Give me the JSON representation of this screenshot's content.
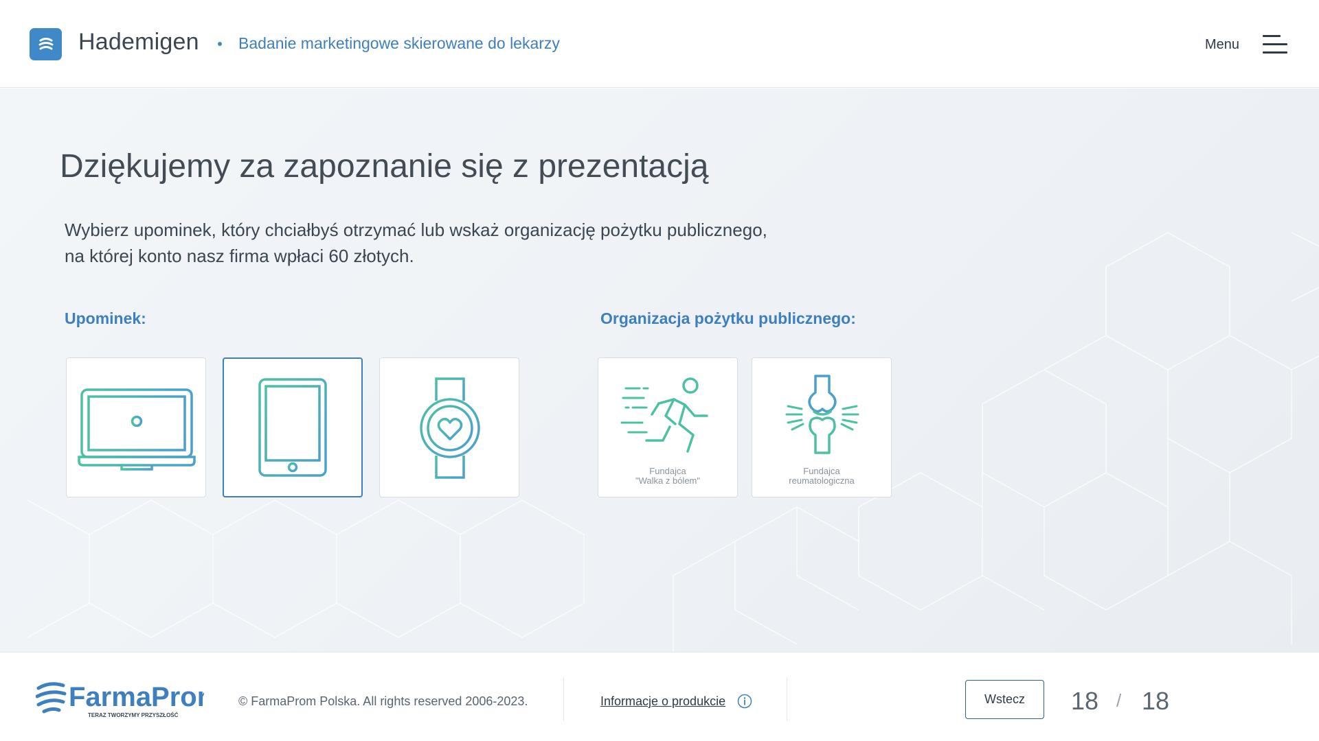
{
  "header": {
    "app_title": "Hademigen",
    "subtitle": "Badanie marketingowe skierowane do lekarzy",
    "menu_label": "Menu"
  },
  "main": {
    "title": "Dziękujemy za zapoznanie się z prezentacją",
    "intro_line1": "Wybierz upominek, który chciałbyś otrzymać lub wskaż organizację pożytku publicznego,",
    "intro_line2": "na której konto nasz firma wpłaci 60 złotych.",
    "gifts_label": "Upominek:",
    "gifts": [
      {
        "icon": "laptop-icon",
        "selected": false
      },
      {
        "icon": "tablet-icon",
        "selected": true
      },
      {
        "icon": "smartwatch-icon",
        "selected": false
      }
    ],
    "orgs_label": "Organizacja pożytku publicznego:",
    "orgs": [
      {
        "icon": "running-man-icon",
        "caption_line1": "Fundajca",
        "caption_line2": "\"Walka z bólem\""
      },
      {
        "icon": "joint-icon",
        "caption_line1": "Fundajca",
        "caption_line2": "reumatologiczna"
      }
    ]
  },
  "footer": {
    "brand": "FarmaProm",
    "brand_tagline": "TERAZ TWORZYMY PRZYSZŁOŚĆ",
    "copyright": "© FarmaProm Polska. All rights reserved 2006-2023.",
    "product_info": "Informacje o produkcie",
    "back_label": "Wstecz",
    "page_current": "18",
    "page_separator": "/",
    "page_total": "18"
  },
  "colors": {
    "accent_blue": "#3d7fbf",
    "icon_teal": "#4cc0a3",
    "icon_blue": "#4a9fcf"
  }
}
